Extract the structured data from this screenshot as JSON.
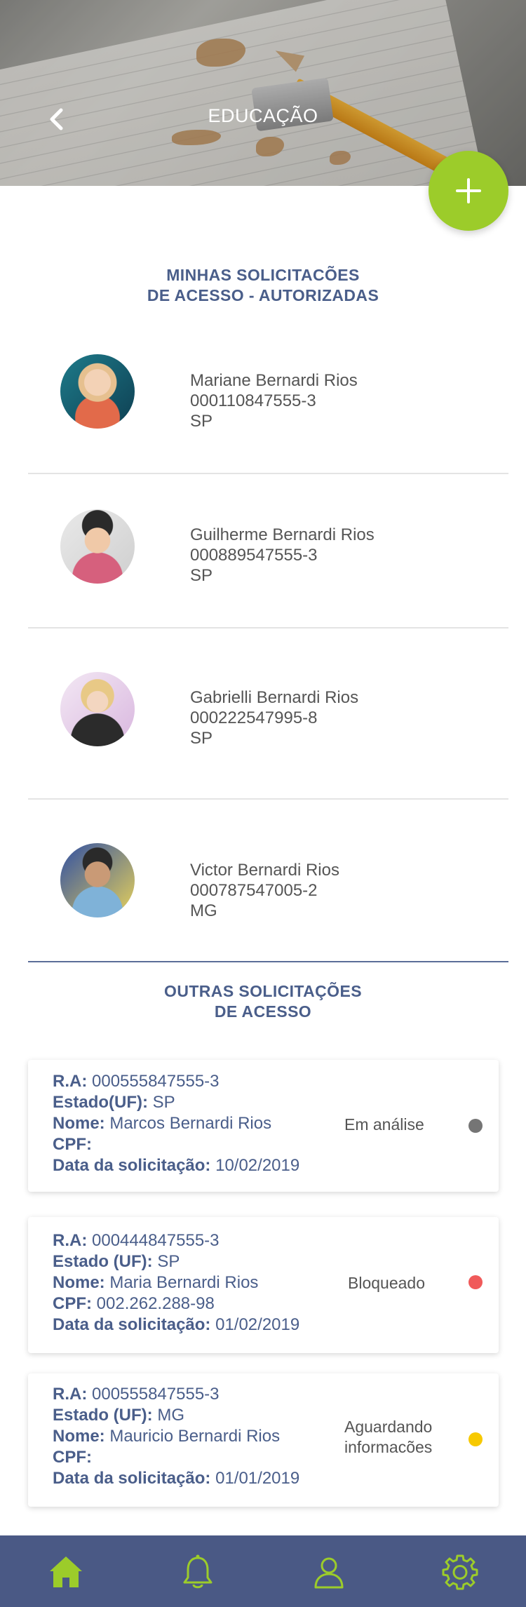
{
  "header": {
    "title": "EDUCAÇÃO",
    "back_icon": "chevron-left-icon",
    "add_icon": "plus-icon"
  },
  "authorized": {
    "title_line1": "MINHAS SOLICITACÕES",
    "title_line2": "DE ACESSO - AUTORIZADAS",
    "people": [
      {
        "name": "Mariane Bernardi Rios",
        "ra": "000110847555-3",
        "state": "SP"
      },
      {
        "name": "Guilherme Bernardi Rios",
        "ra": "000889547555-3",
        "state": "SP"
      },
      {
        "name": "Gabrielli Bernardi Rios",
        "ra": "000222547995-8",
        "state": "SP"
      },
      {
        "name": "Victor Bernardi Rios",
        "ra": "000787547005-2",
        "state": "MG"
      }
    ]
  },
  "others": {
    "title_line1": "OUTRAS SOLICITAÇÕES",
    "title_line2": "DE ACESSO",
    "requests": [
      {
        "ra_label": "R.A:",
        "ra": "000555847555-3",
        "state_label": "Estado(UF):",
        "state": "SP",
        "name_label": "Nome:",
        "name": "Marcos Bernardi Rios",
        "cpf_label": "CPF:",
        "cpf": "",
        "date_label": "Data da solicitação:",
        "date": "10/02/2019",
        "status_line1": "Em análise",
        "status_line2": "",
        "status_color": "#757575"
      },
      {
        "ra_label": "R.A:",
        "ra": "000444847555-3",
        "state_label": "Estado (UF):",
        "state": "SP",
        "name_label": "Nome:",
        "name": "Maria Bernardi Rios",
        "cpf_label": "CPF:",
        "cpf": "002.262.288-98",
        "date_label": "Data da solicitação:",
        "date": "01/02/2019",
        "status_line1": "Bloqueado",
        "status_line2": "",
        "status_color": "#f05a5a"
      },
      {
        "ra_label": "R.A:",
        "ra": "000555847555-3",
        "state_label": "Estado (UF):",
        "state": "MG",
        "name_label": "Nome:",
        "name": "Mauricio Bernardi Rios",
        "cpf_label": "CPF:",
        "cpf": "",
        "date_label": "Data da solicitação:",
        "date": "01/01/2019",
        "status_line1": "Aguardando",
        "status_line2": "informacões",
        "status_color": "#f7c900"
      }
    ]
  },
  "bottom_nav": {
    "items": [
      "home-icon",
      "bell-icon",
      "user-icon",
      "gear-icon"
    ],
    "active_color": "#9ccc2a"
  }
}
